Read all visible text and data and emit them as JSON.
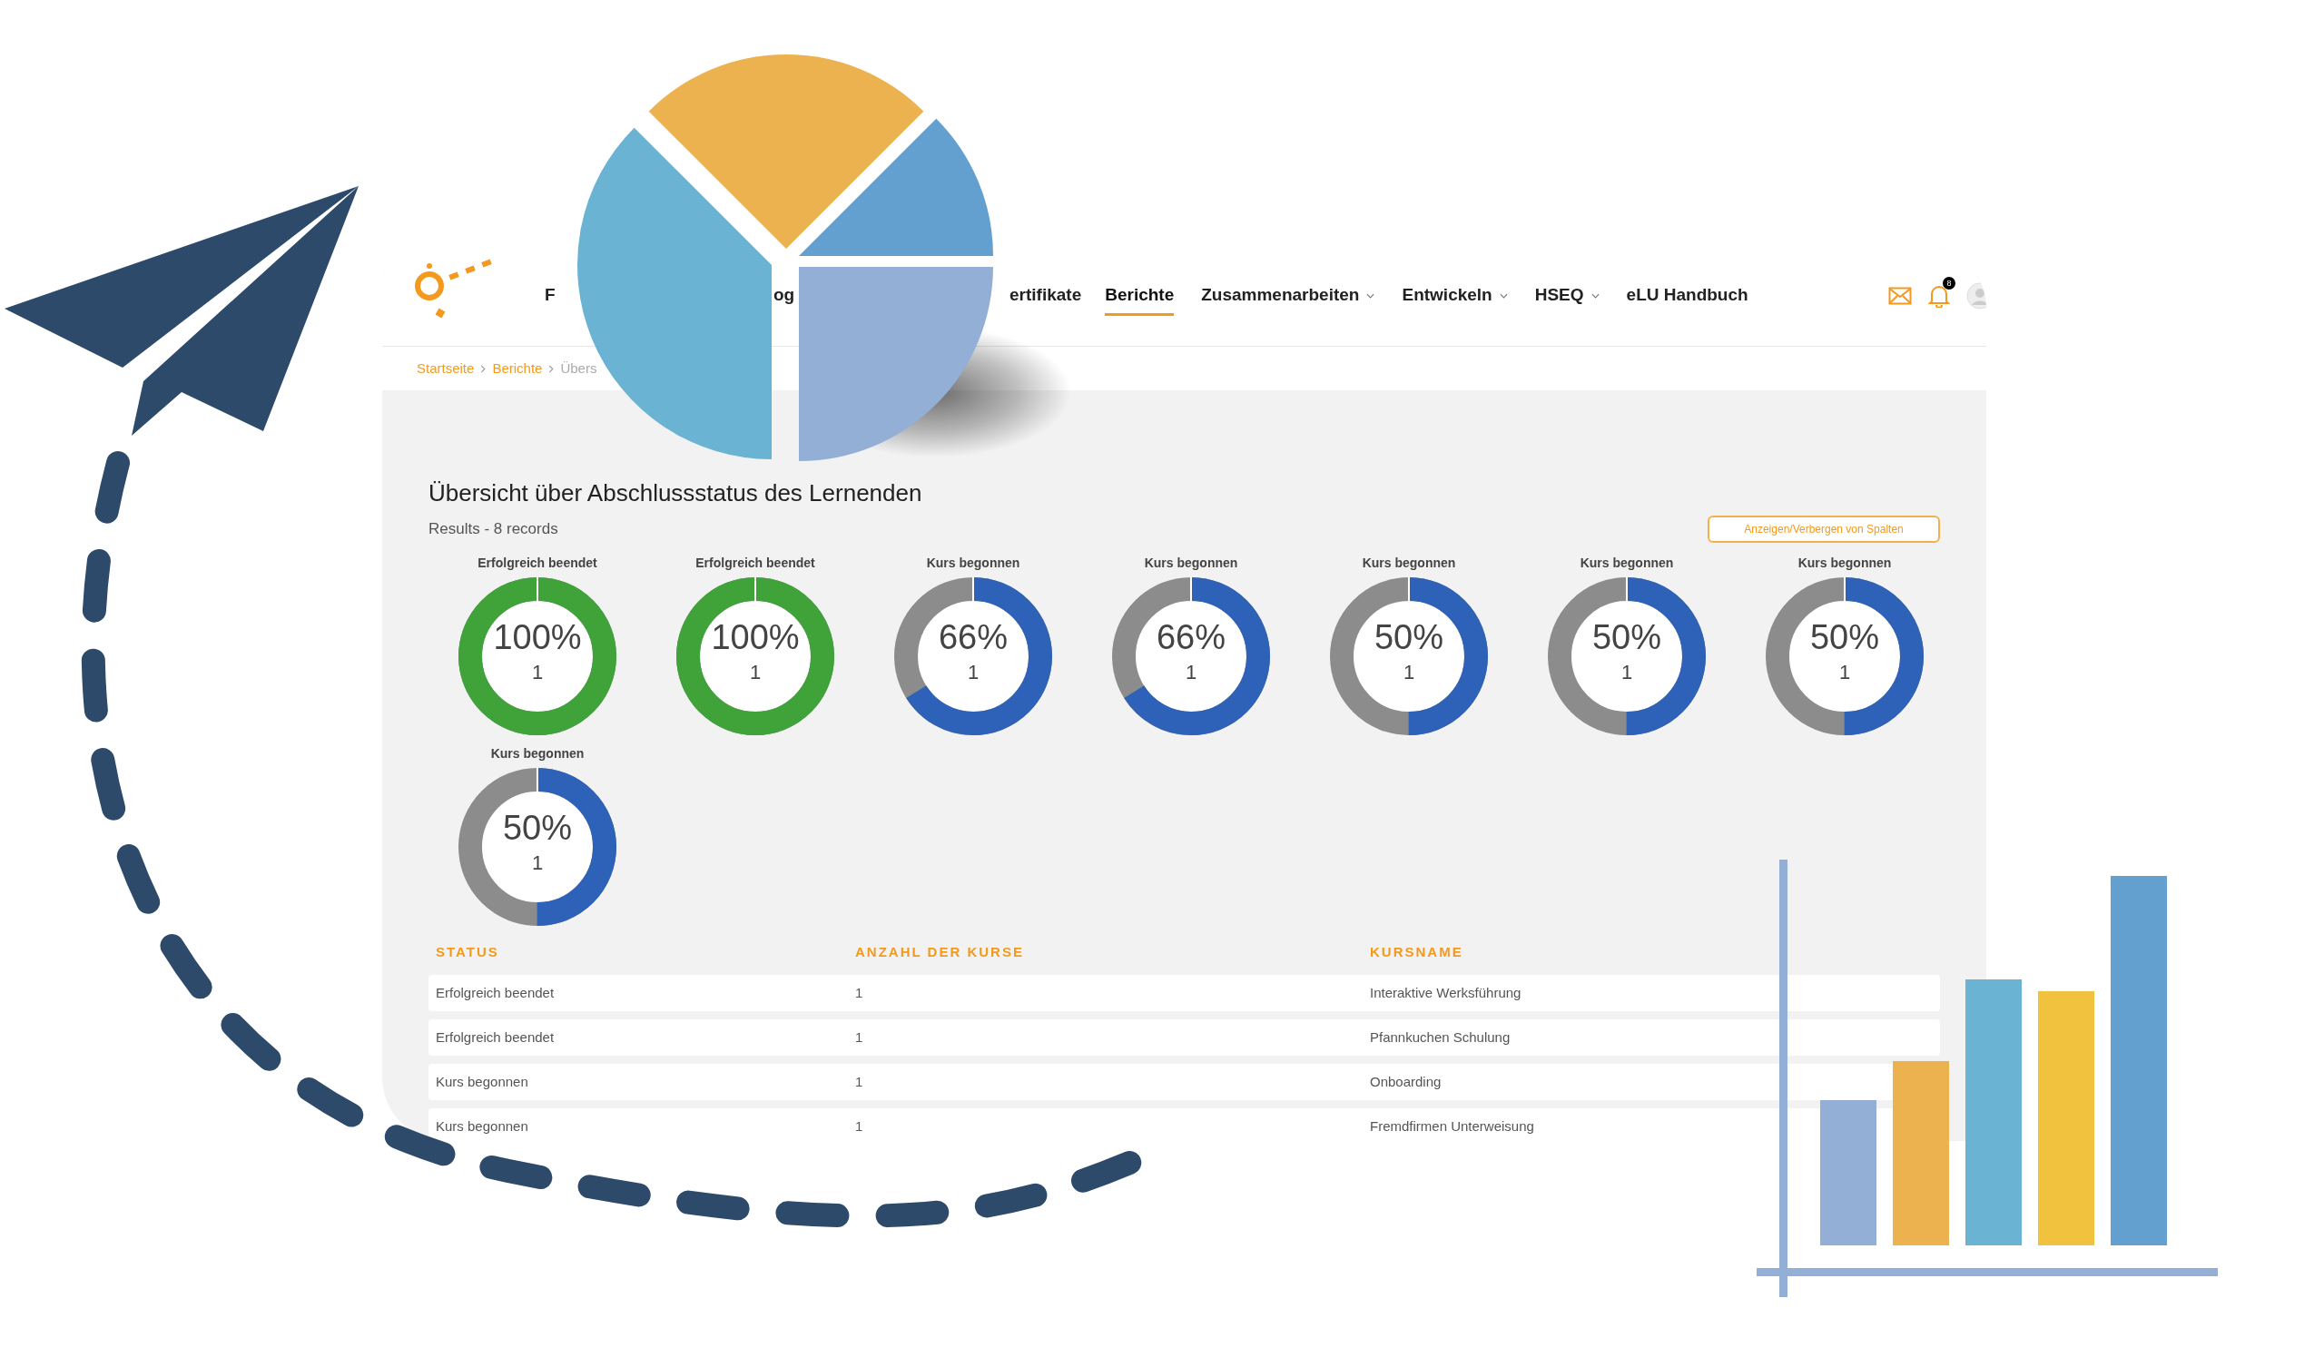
{
  "nav": {
    "items": [
      {
        "label": "F",
        "selected": false,
        "dropdown": false
      },
      {
        "label": "og",
        "selected": false,
        "dropdown": false
      },
      {
        "label": "ertifikate",
        "selected": false,
        "dropdown": false
      },
      {
        "label": "Berichte",
        "selected": true,
        "dropdown": false
      },
      {
        "label": "Zusammenarbeiten",
        "selected": false,
        "dropdown": true
      },
      {
        "label": "Entwickeln",
        "selected": false,
        "dropdown": true
      },
      {
        "label": "HSEQ",
        "selected": false,
        "dropdown": true
      },
      {
        "label": "eLU Handbuch",
        "selected": false,
        "dropdown": false
      }
    ],
    "notification_count": "8"
  },
  "breadcrumb": [
    "Startseite",
    "Berichte",
    "Übers"
  ],
  "title": "Übersicht über Abschlussstatus des Lernenden",
  "results": "Results - 8 records",
  "columns_button": "Anzeigen/Verbergen von Spalten",
  "donuts": [
    {
      "label": "Erfolgreich beendet",
      "percent": "100%",
      "count": "1",
      "level": 1,
      "color": "#3fa33a"
    },
    {
      "label": "Erfolgreich beendet",
      "percent": "100%",
      "count": "1",
      "level": 1,
      "color": "#3fa33a"
    },
    {
      "label": "Kurs begonnen",
      "percent": "66%",
      "count": "1",
      "level": 0.66,
      "color": "#2e62b8"
    },
    {
      "label": "Kurs begonnen",
      "percent": "66%",
      "count": "1",
      "level": 0.66,
      "color": "#2e62b8"
    },
    {
      "label": "Kurs begonnen",
      "percent": "50%",
      "count": "1",
      "level": 0.5,
      "color": "#2e62b8"
    },
    {
      "label": "Kurs begonnen",
      "percent": "50%",
      "count": "1",
      "level": 0.5,
      "color": "#2e62b8"
    },
    {
      "label": "Kurs begonnen",
      "percent": "50%",
      "count": "1",
      "level": 0.5,
      "color": "#2e62b8"
    },
    {
      "label": "Kurs begonnen",
      "percent": "50%",
      "count": "1",
      "level": 0.5,
      "color": "#2e62b8"
    }
  ],
  "table": {
    "columns": [
      "STATUS",
      "ANZAHL DER KURSE",
      "KURSNAME"
    ],
    "rows": [
      [
        "Erfolgreich beendet",
        "1",
        "Interaktive Werksführung"
      ],
      [
        "Erfolgreich beendet",
        "1",
        "Pfannkuchen Schulung"
      ],
      [
        "Kurs begonnen",
        "1",
        "Onboarding"
      ],
      [
        "Kurs begonnen",
        "1",
        "Fremdfirmen Unterweisung"
      ]
    ]
  }
}
